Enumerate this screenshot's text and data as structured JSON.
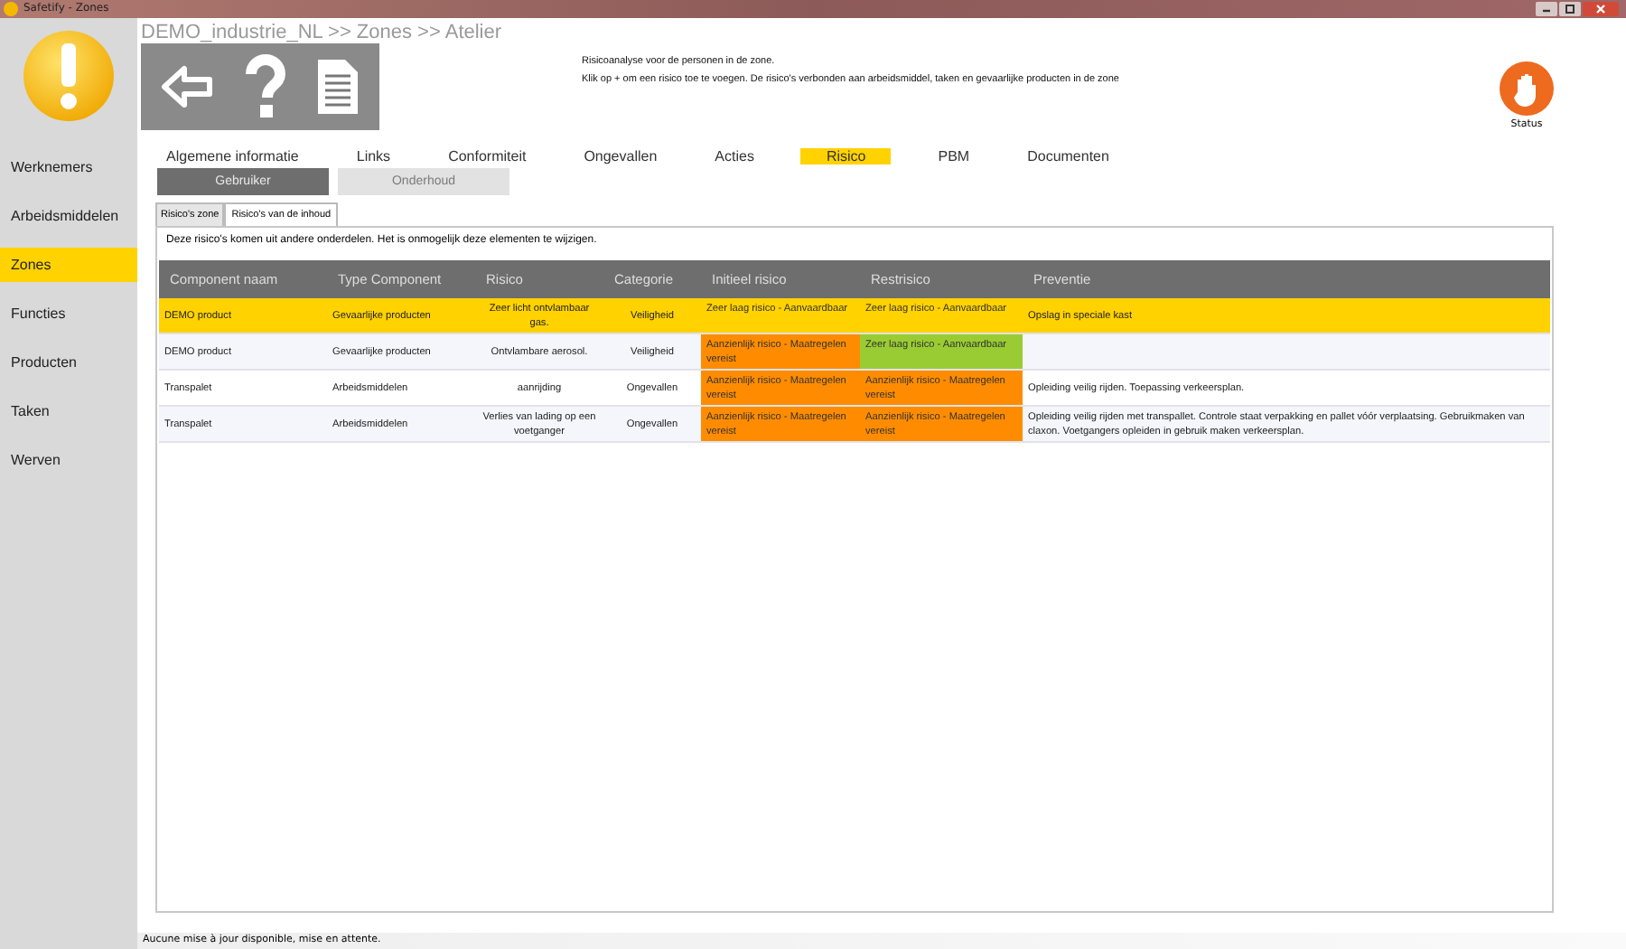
{
  "window": {
    "title": "Safetify - Zones"
  },
  "sidebar": {
    "items": [
      {
        "label": "Werknemers",
        "selected": false
      },
      {
        "label": "Arbeidsmiddelen",
        "selected": false
      },
      {
        "label": "Zones",
        "selected": true
      },
      {
        "label": "Functies",
        "selected": false
      },
      {
        "label": "Producten",
        "selected": false
      },
      {
        "label": "Taken",
        "selected": false
      },
      {
        "label": "Werven",
        "selected": false
      }
    ]
  },
  "breadcrumb": "DEMO_industrie_NL >> Zones >> Atelier",
  "description": [
    "Risicoanalyse voor de personen in de zone.",
    "Klik op + om een risico toe te voegen. De risico's verbonden aan arbeidsmiddel, taken en gevaarlijke producten in de zone"
  ],
  "status": {
    "label": "Status"
  },
  "tabs": [
    {
      "label": "Algemene informatie",
      "selected": false
    },
    {
      "label": "Links",
      "selected": false
    },
    {
      "label": "Conformiteit",
      "selected": false
    },
    {
      "label": "Ongevallen",
      "selected": false
    },
    {
      "label": "Acties",
      "selected": false
    },
    {
      "label": "Risico",
      "selected": true
    },
    {
      "label": "PBM",
      "selected": false
    },
    {
      "label": "Documenten",
      "selected": false
    }
  ],
  "mode_buttons": [
    {
      "label": "Gebruiker",
      "disabled": false
    },
    {
      "label": "Onderhoud",
      "disabled": true
    }
  ],
  "subtabs": [
    {
      "label": "Risico's zone",
      "selected": false
    },
    {
      "label": "Risico's van de inhoud",
      "selected": true
    }
  ],
  "info": "Deze risico's komen uit andere onderdelen. Het is onmogelijk deze elementen te wijzigen.",
  "table": {
    "columns": [
      "Component naam",
      "Type Component",
      "Risico",
      "Categorie",
      "Initieel risico",
      "Restrisico",
      "Preventie"
    ],
    "rows": [
      {
        "selected": true,
        "component": "DEMO product",
        "type": "Gevaarlijke producten",
        "risico": "Zeer licht ontvlambaar gas.",
        "categorie": "Veiligheid",
        "initieel": {
          "text": "Zeer laag risico - Aanvaardbaar",
          "color": "#ffd200"
        },
        "rest": {
          "text": "Zeer laag risico - Aanvaardbaar",
          "color": "#ffd200"
        },
        "preventie": "Opslag in speciale kast"
      },
      {
        "selected": false,
        "component": "DEMO product",
        "type": "Gevaarlijke producten",
        "risico": "Ontvlambare aerosol.",
        "categorie": "Veiligheid",
        "initieel": {
          "text": "Aanzienlijk risico - Maatregelen vereist",
          "color": "#ff8c00"
        },
        "rest": {
          "text": "Zeer laag risico - Aanvaardbaar",
          "color": "#99cc33"
        }
      },
      {
        "selected": false,
        "component": "Transpalet",
        "type": "Arbeidsmiddelen",
        "risico": "aanrijding",
        "categorie": "Ongevallen",
        "initieel": {
          "text": "Aanzienlijk risico - Maatregelen vereist",
          "color": "#ff8c00"
        },
        "rest": {
          "text": "Aanzienlijk risico - Maatregelen vereist",
          "color": "#ff8c00"
        },
        "preventie": "Opleiding veilig rijden. Toepassing verkeersplan."
      },
      {
        "selected": false,
        "component": "Transpalet",
        "type": "Arbeidsmiddelen",
        "risico": "Verlies van lading op een voetganger",
        "categorie": "Ongevallen",
        "initieel": {
          "text": "Aanzienlijk risico - Maatregelen vereist",
          "color": "#ff8c00"
        },
        "rest": {
          "text": "Aanzienlijk risico - Maatregelen vereist",
          "color": "#ff8c00"
        },
        "preventie": "Opleiding veilig rijden met transpallet. Controle staat verpakking en pallet vóór verplaatsing. Gebruikmaken van claxon. Voetgangers opleiden in gebruik maken verkeersplan."
      }
    ]
  },
  "status_bar": "Aucune mise à jour disponible, mise en attente."
}
